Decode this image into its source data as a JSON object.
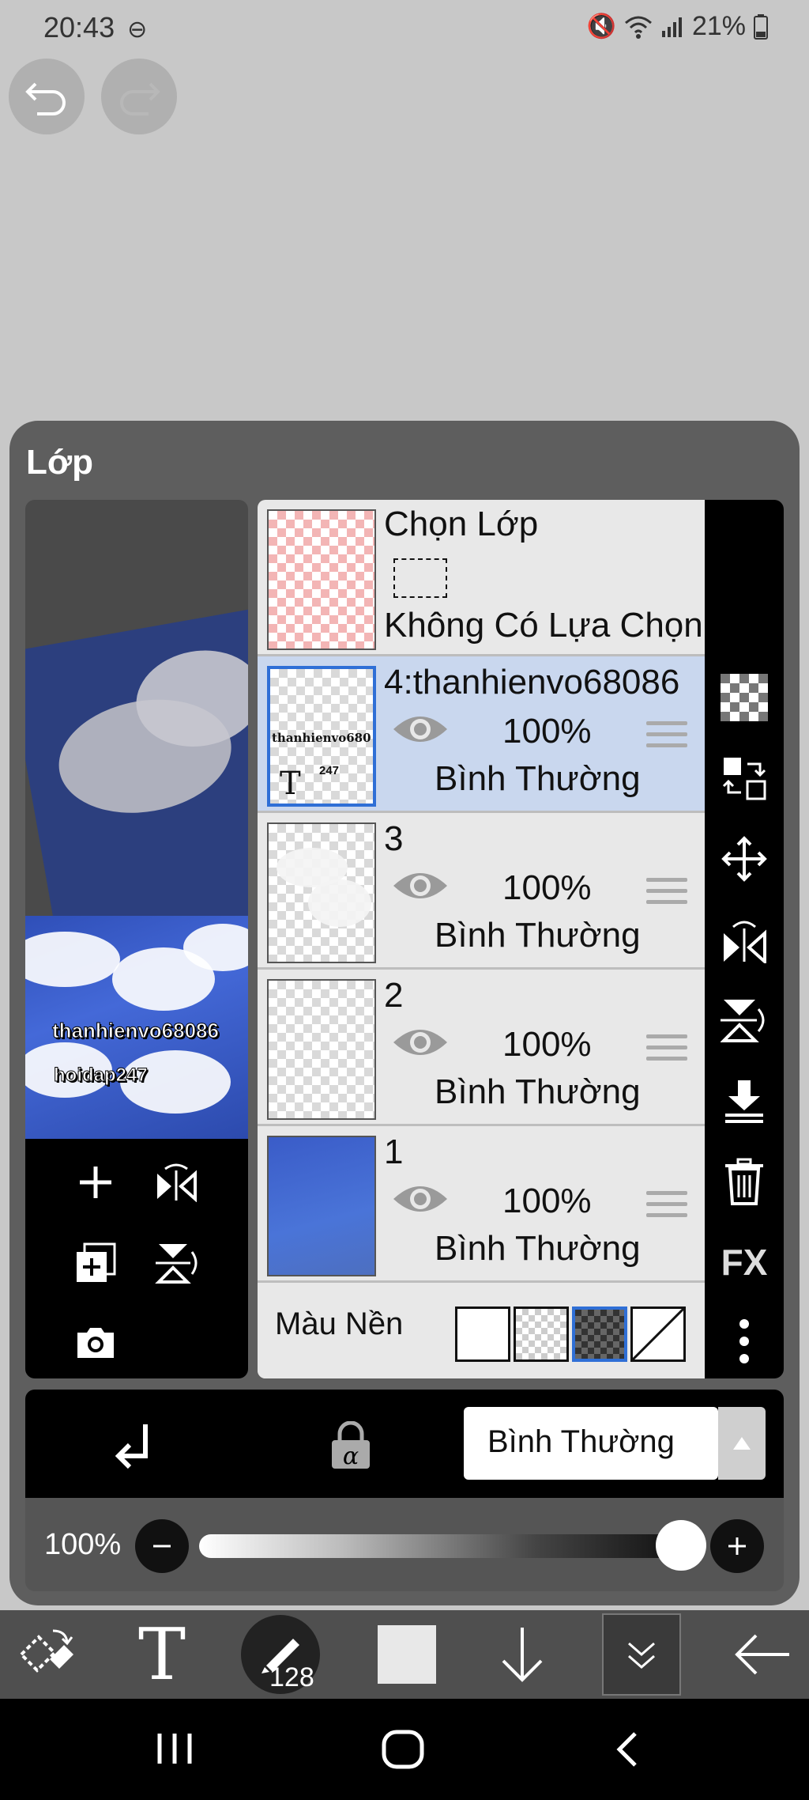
{
  "status": {
    "time": "20:43",
    "battery": "21%"
  },
  "panel": {
    "title": "Lớp"
  },
  "preview": {
    "text1": "thanhienvo68086",
    "text2": "hoidap247"
  },
  "selection_row": {
    "title": "Chọn Lớp",
    "subtitle": "Không Có Lựa Chọn"
  },
  "layers": [
    {
      "name": "4:thanhienvo68086",
      "opacity": "100%",
      "blend": "Bình Thường",
      "thumb_text": "thanhienvo680",
      "thumb_badge": "247"
    },
    {
      "name": "3",
      "opacity": "100%",
      "blend": "Bình Thường"
    },
    {
      "name": "2",
      "opacity": "100%",
      "blend": "Bình Thường"
    },
    {
      "name": "1",
      "opacity": "100%",
      "blend": "Bình Thường"
    }
  ],
  "background": {
    "label": "Màu Nền"
  },
  "right_toolbar": {
    "fx_label": "FX"
  },
  "options": {
    "blend_mode": "Bình Thường"
  },
  "opacity": {
    "label": "100%",
    "value": 1.0
  },
  "bottom_toolbar": {
    "brush_size": "128"
  }
}
